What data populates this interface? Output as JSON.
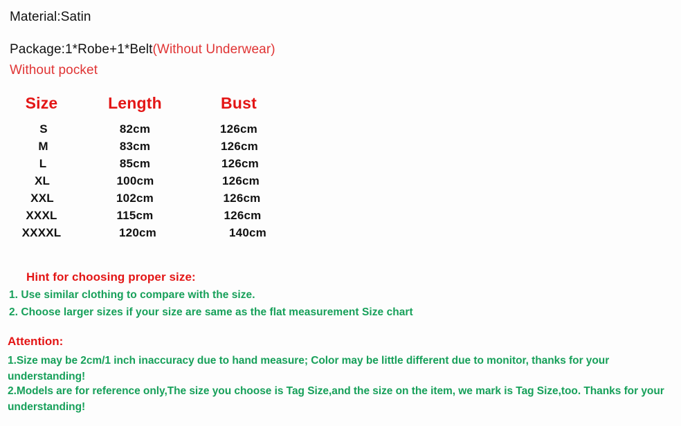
{
  "product_info": {
    "material_line": "Material:Satin",
    "package_prefix": "Package:1*Robe+1*Belt",
    "package_note": "(Without Underwear)",
    "pocket_note": "Without pocket"
  },
  "size_chart": {
    "headers": {
      "size": "Size",
      "length": "Length",
      "bust": "Bust"
    },
    "rows": [
      {
        "size": "S",
        "length": "82cm",
        "bust": "126cm"
      },
      {
        "size": "M",
        "length": "83cm",
        "bust": "126cm"
      },
      {
        "size": "L",
        "length": "85cm",
        "bust": "126cm"
      },
      {
        "size": "XL",
        "length": "100cm",
        "bust": "126cm"
      },
      {
        "size": "XXL",
        "length": "102cm",
        "bust": "126cm"
      },
      {
        "size": "XXXL",
        "length": "115cm",
        "bust": "126cm"
      },
      {
        "size": "XXXXL",
        "length": "120cm",
        "bust": "140cm"
      }
    ]
  },
  "hint": {
    "title": "Hint for choosing proper size:",
    "items": [
      "1. Use similar clothing to compare with the size.",
      "2. Choose larger sizes if your size are same as the flat measurement Size chart"
    ]
  },
  "attention": {
    "title": "Attention:",
    "items": [
      "1.Size may be 2cm/1 inch inaccuracy due to hand measure; Color may be little different   due to monitor, thanks for your understanding!",
      "2.Models are for reference only,The size you choose is Tag Size,and the size on the item,  we mark is Tag Size,too. Thanks for your understanding!"
    ]
  },
  "colors": {
    "red": "#e31515",
    "red_soft": "#e03434",
    "green": "#17a05a",
    "text": "#111111",
    "background": "#fdfdfd"
  }
}
